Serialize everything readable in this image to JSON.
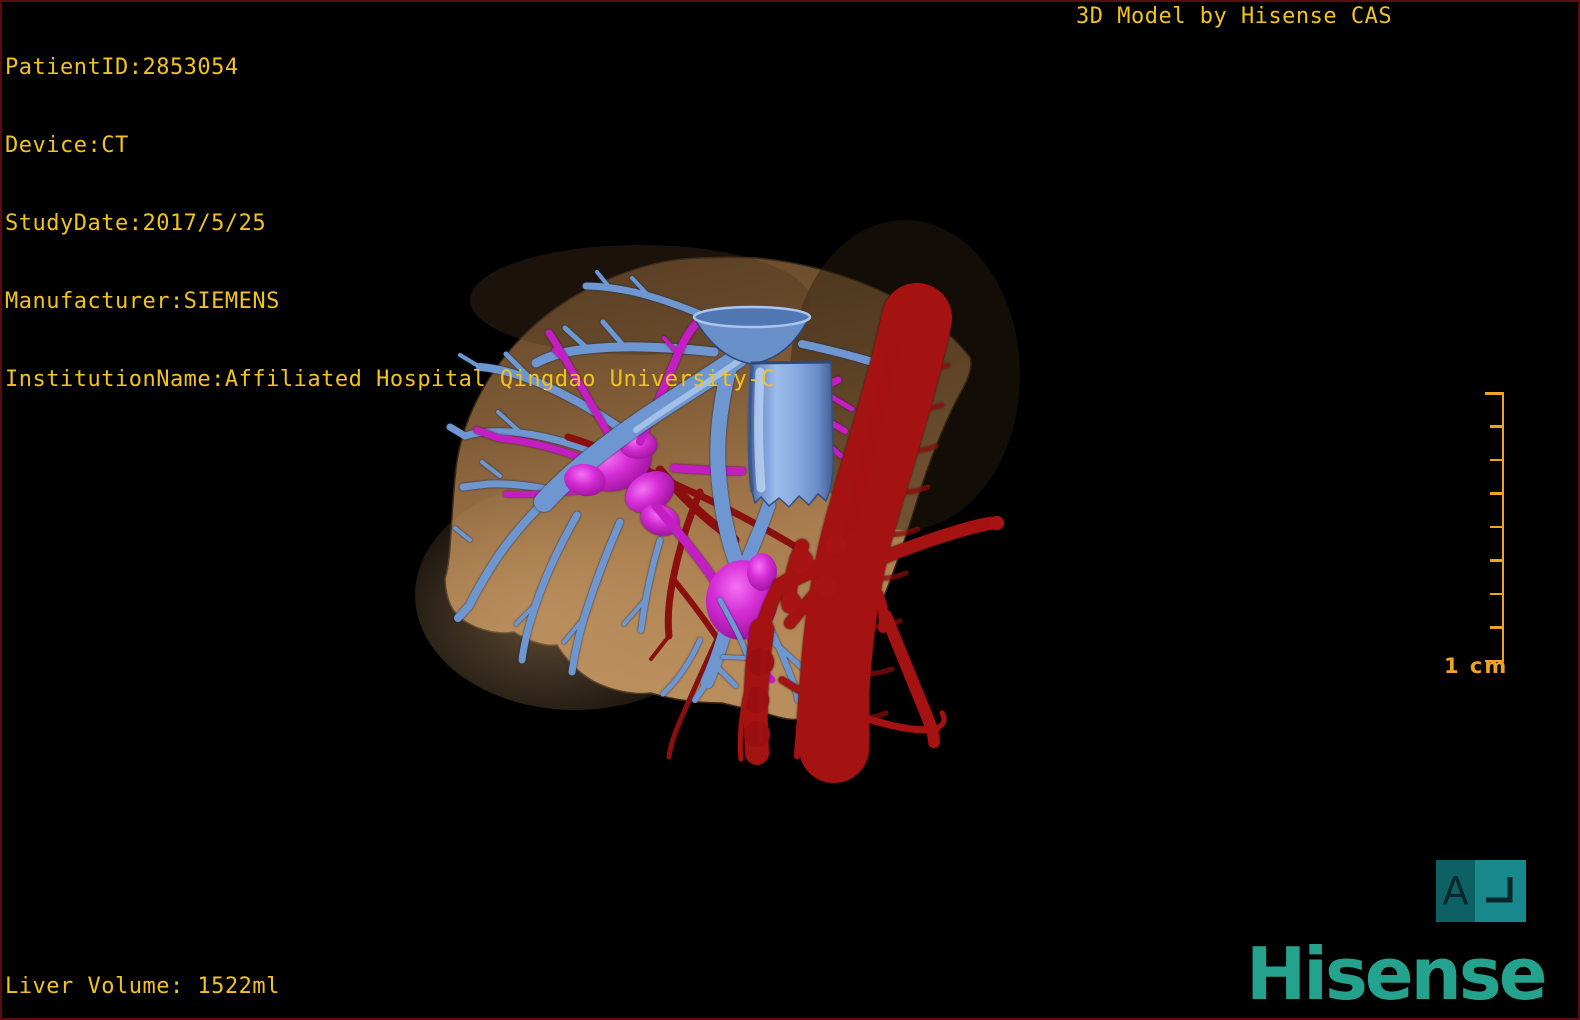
{
  "header": {
    "patient_info_lines": [
      "PatientID:2853054",
      "Device:CT",
      "StudyDate:2017/5/25",
      "Manufacturer:SIEMENS",
      "InstitutionName:Affiliated Hospital Qingdao University-C"
    ],
    "watermark": "3D Model by Hisense CAS"
  },
  "footer": {
    "liver_volume": "Liver Volume: 1522ml",
    "brand": "Hisense"
  },
  "scale_bar": {
    "label": "1 cm"
  },
  "orientation_cube": {
    "face_label": "A"
  },
  "colors": {
    "background": "#000000",
    "frame_border": "#5a0d11",
    "info_text": "#f2c31f",
    "scale_bar": "#efa31f",
    "logo_teal": "#23a38e",
    "cube_face_front": "#0d6165",
    "cube_face_side": "#17888c",
    "cube_glyph": "#07262a",
    "vein_blue": "#6e96d0",
    "vena_cava_blue": "#8fb2e6",
    "portal_magenta": "#c21ec2",
    "artery_red": "#a51212",
    "artery_dark_red": "#8b0f0f",
    "liver_tan": "#a07447"
  }
}
